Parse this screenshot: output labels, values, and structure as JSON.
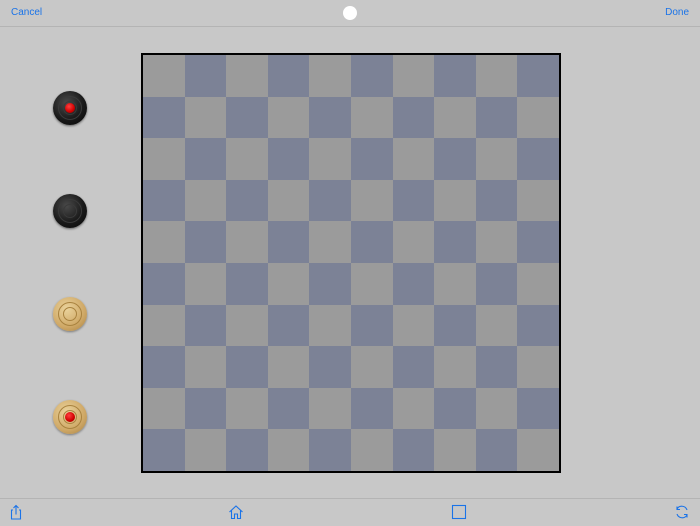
{
  "toolbar": {
    "cancel_label": "Cancel",
    "done_label": "Done",
    "turn_indicator_color": "#ffffff"
  },
  "board": {
    "size": 10,
    "light_color": "#9b9b9b",
    "dark_color": "#7c8296",
    "border_color": "#000000"
  },
  "palette": [
    {
      "name": "black-king",
      "color": "black",
      "king": true
    },
    {
      "name": "black-man",
      "color": "black",
      "king": false
    },
    {
      "name": "tan-man",
      "color": "tan",
      "king": false
    },
    {
      "name": "tan-king",
      "color": "tan",
      "king": true
    }
  ],
  "bottom_toolbar": {
    "icons": [
      "share-icon",
      "home-icon",
      "square-icon",
      "refresh-icon"
    ],
    "accent_color": "#1a73e8"
  }
}
